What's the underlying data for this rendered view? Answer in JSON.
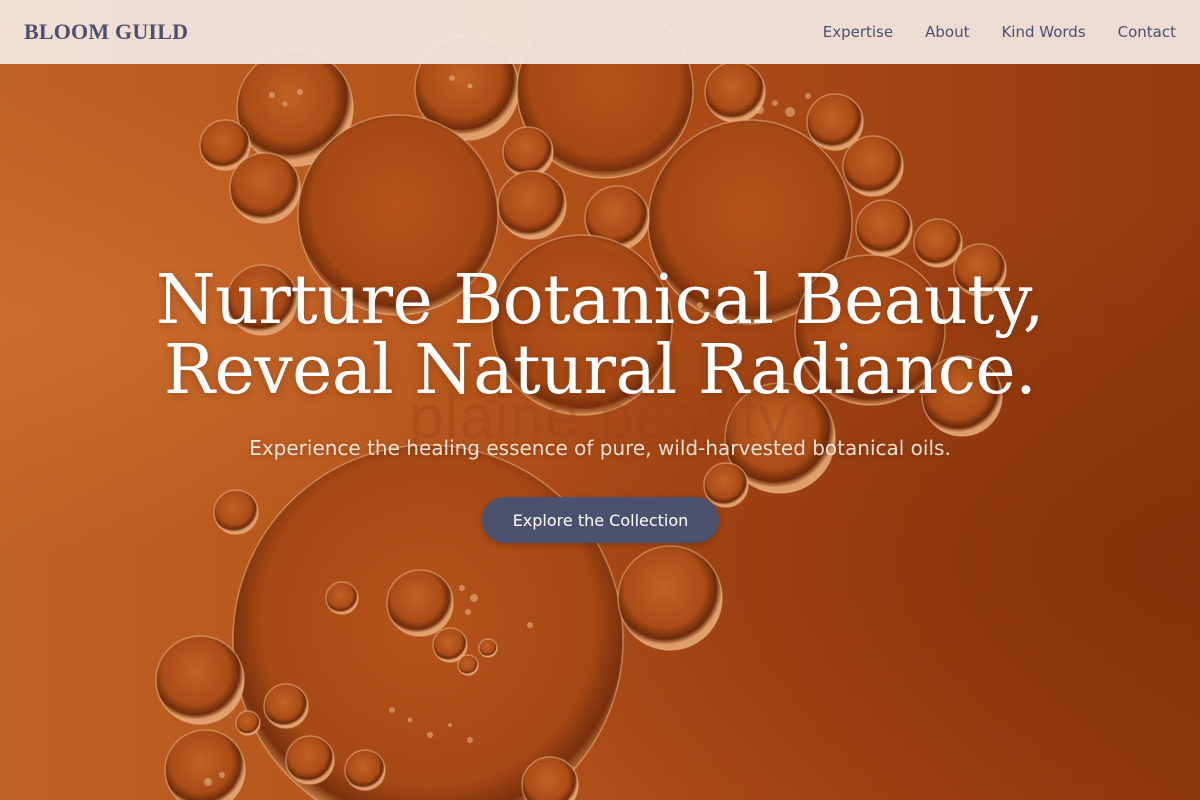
{
  "header": {
    "logo": "BLOOM GUILD",
    "nav": [
      {
        "label": "Expertise"
      },
      {
        "label": "About"
      },
      {
        "label": "Kind Words"
      },
      {
        "label": "Contact"
      }
    ]
  },
  "hero": {
    "headline_line1": "Nurture Botanical Beauty,",
    "headline_line2": "Reveal Natural Radiance.",
    "subheadline": "Experience the healing essence of pure, wild-harvested botanical oils.",
    "cta_label": "Explore the Collection",
    "watermark": "plaine.beauty"
  },
  "colors": {
    "header_bg": "#f4e8e2",
    "brand_text": "#4b5070",
    "cta_bg": "#4c5170",
    "hero_base": "#b8531a"
  },
  "icons": [
    "oil-droplet-background-image"
  ]
}
